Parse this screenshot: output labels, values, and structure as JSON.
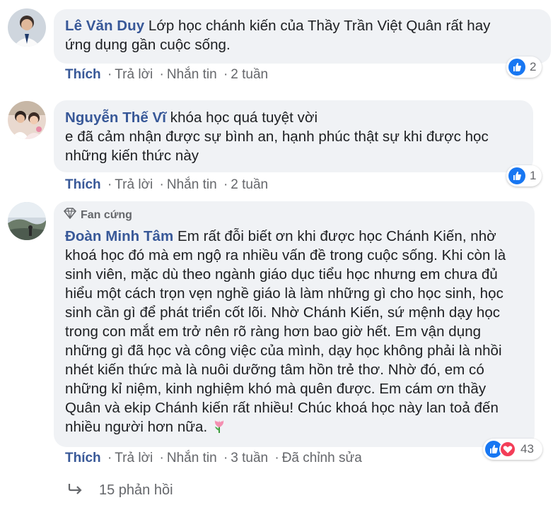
{
  "comments": [
    {
      "author": "Lê Văn Duy",
      "text": "Lớp học chánh kiến của Thầy Trần Việt Quân rất hay\nứng dụng gần cuộc sống.",
      "actions": {
        "like": "Thích",
        "reply": "Trả lời",
        "message": "Nhắn tin",
        "time": "2 tuần"
      },
      "reactions": {
        "count": "2"
      }
    },
    {
      "author": "Nguyễn Thế Vĩ",
      "text": "khóa học quá tuyệt vời\ne đã cảm nhận được sự bình an, hạnh phúc thật sự khi được học\nnhững kiến thức này",
      "actions": {
        "like": "Thích",
        "reply": "Trả lời",
        "message": "Nhắn tin",
        "time": "2 tuần"
      },
      "reactions": {
        "count": "1"
      }
    },
    {
      "badge": "Fan cứng",
      "author": "Đoàn Minh Tâm",
      "text": "Em rất đỗi biết ơn khi được học Chánh Kiến, nhờ\nkhoá học đó mà em ngộ ra nhiều vấn đề trong cuộc sống. Khi còn là\nsinh viên, mặc dù theo ngành giáo dục tiểu học nhưng em chưa đủ\nhiểu một cách trọn vẹn nghề giáo là làm những gì cho học sinh, học\nsinh cần gì để phát triển cốt lõi. Nhờ Chánh Kiến, sứ mệnh dạy học\ntrong con mắt em trở nên rõ ràng hơn bao giờ hết. Em vận dụng\nnhững gì đã học và công việc của mình, dạy học không phải là nhồi\nnhét kiến thức mà là nuôi dưỡng tâm hồn trẻ thơ. Nhờ đó, em có\nnhững kỉ niệm, kinh nghiệm khó mà quên được. Em cám ơn thầy\nQuân và ekip Chánh kiến rất nhiều! Chúc khoá học này lan toả đến\nnhiều người hơn nữa. ",
      "actions": {
        "like": "Thích",
        "reply": "Trả lời",
        "message": "Nhắn tin",
        "time": "3 tuần",
        "edited": "Đã chỉnh sửa"
      },
      "reactions": {
        "count": "43"
      }
    }
  ],
  "replies_link": "15 phản hồi",
  "colors": {
    "link": "#385898",
    "like": "#1877f2",
    "love": "#f33e58",
    "bubble": "#f0f2f5",
    "meta": "#65676b"
  }
}
